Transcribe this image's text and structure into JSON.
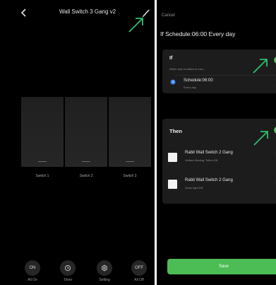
{
  "left": {
    "header": {
      "title": "Wall Switch 3 Gang v2"
    },
    "switches": [
      {
        "label": "Switch 1"
      },
      {
        "label": "Switch 2"
      },
      {
        "label": "Switch 3"
      }
    ],
    "bottom_bar": [
      {
        "icon": "ON",
        "label": "All On"
      },
      {
        "icon": "clock-icon",
        "label": "Timer"
      },
      {
        "icon": "gear-icon",
        "label": "Setting"
      },
      {
        "icon": "OFF",
        "label": "All Off"
      }
    ]
  },
  "right": {
    "cancel": "Cancel",
    "title": "If Schedule:06:00 Every day",
    "if_card": {
      "heading": "If",
      "subtitle": "When any condition is met—",
      "row_title": "Schedule:06:00",
      "row_subtitle": "Every day"
    },
    "then_card": {
      "heading": "Then",
      "rows": [
        {
          "title": "Rabit Wall Switch 2 Gang",
          "subtitle": "Vertaco Baxing: Toltno:Off"
        },
        {
          "title": "Rabit Wall Switch 2 Gang",
          "subtitle": "Down light:Off"
        }
      ]
    },
    "save": "Save"
  },
  "colors": {
    "accent": "#4cbd55",
    "arrow": "#2ec06c",
    "background": "#000000",
    "card": "#1c1c1c"
  }
}
